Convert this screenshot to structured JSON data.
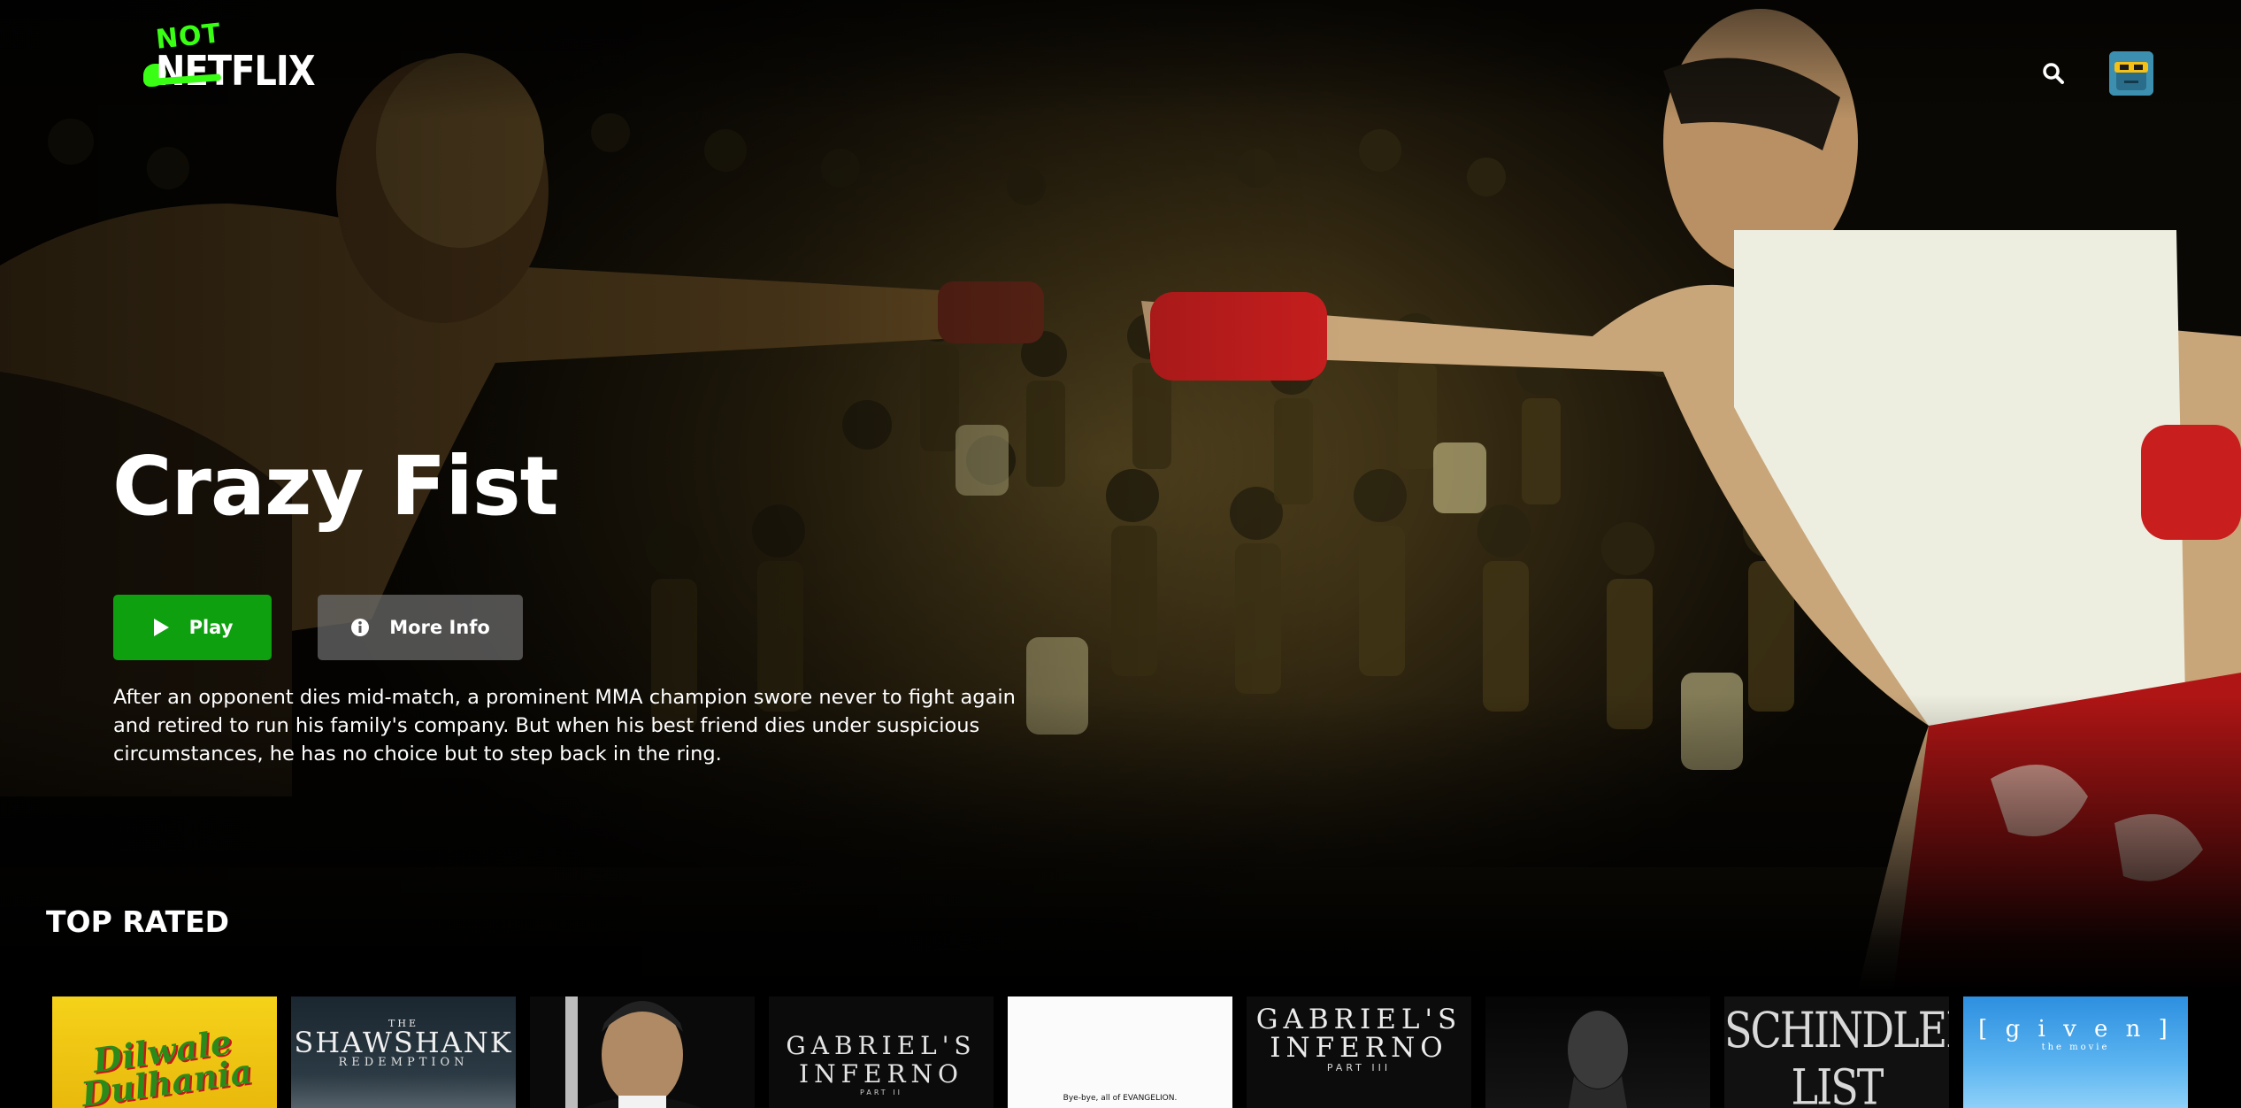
{
  "app": {
    "logo_top": "NOT",
    "logo_word": "NETFLIX"
  },
  "icons": {
    "search": "search-icon",
    "avatar": "avatar-sunglasses",
    "play": "play-icon",
    "info": "info-icon"
  },
  "colors": {
    "accent": "#39ff14",
    "play_button": "#0fa00f",
    "more_info_button": "#6e6e6e",
    "background": "#000000"
  },
  "hero": {
    "title": "Crazy Fist",
    "play_label": "Play",
    "more_info_label": "More Info",
    "description": "After an opponent dies mid-match, a prominent MMA champion swore never to fight again and retired to run his family's company. But when his best friend dies under suspicious circumstances, he has no choice but to step back in the ring."
  },
  "row": {
    "title": "TOP RATED",
    "posters": [
      {
        "title_text": "Dilwale Dulhania"
      },
      {
        "pre": "THE",
        "title_text": "SHAWSHANK",
        "sub": "REDEMPTION"
      },
      {
        "title_text": ""
      },
      {
        "title_text": "GABRIEL'S INFERNO",
        "part": "PART II"
      },
      {
        "title_text": "Bye-bye, all of EVANGELION."
      },
      {
        "title_text": "GABRIEL'S INFERNO",
        "part": "PART III"
      },
      {
        "title_text": ""
      },
      {
        "title_text": "SCHINDLER'S LIST"
      },
      {
        "title_text": "[ g i v e n ]",
        "sub": "the movie"
      }
    ]
  }
}
